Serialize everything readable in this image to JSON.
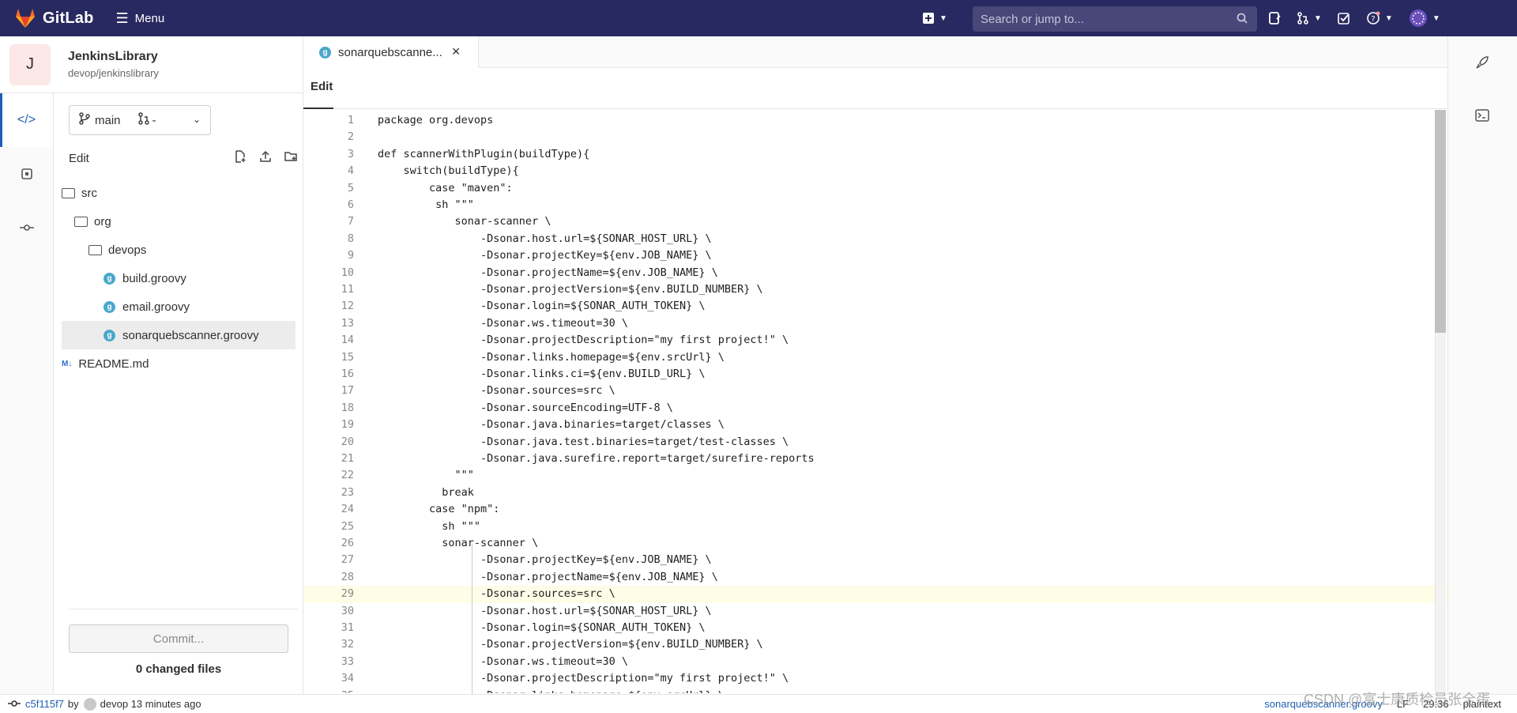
{
  "navbar": {
    "brand": "GitLab",
    "menu_label": "Menu",
    "search_placeholder": "Search or jump to...",
    "colors": {
      "background": "#292961",
      "accent": "#fc6d26"
    }
  },
  "project": {
    "avatar_letter": "J",
    "name": "JenkinsLibrary",
    "path": "devop/jenkinslibrary"
  },
  "tree": {
    "branch": "main",
    "mr": "-",
    "edit_label": "Edit",
    "items": [
      {
        "name": "src",
        "type": "folder",
        "indent": 0
      },
      {
        "name": "org",
        "type": "folder",
        "indent": 1
      },
      {
        "name": "devops",
        "type": "folder",
        "indent": 2
      },
      {
        "name": "build.groovy",
        "type": "groovy",
        "indent": 3
      },
      {
        "name": "email.groovy",
        "type": "groovy",
        "indent": 3
      },
      {
        "name": "sonarquebscanner.groovy",
        "type": "groovy",
        "indent": 3,
        "selected": true
      },
      {
        "name": "README.md",
        "type": "md",
        "indent": 0
      }
    ],
    "commit_label": "Commit...",
    "changed_files": "0 changed files"
  },
  "editor": {
    "tab_name": "sonarquebscanne...",
    "mode_label": "Edit",
    "highlight_line": 29,
    "lines": [
      "package org.devops",
      "",
      "def scannerWithPlugin(buildType){",
      "    switch(buildType){",
      "        case \"maven\":",
      "         sh \"\"\"",
      "            sonar-scanner \\",
      "                -Dsonar.host.url=${SONAR_HOST_URL} \\",
      "                -Dsonar.projectKey=${env.JOB_NAME} \\",
      "                -Dsonar.projectName=${env.JOB_NAME} \\",
      "                -Dsonar.projectVersion=${env.BUILD_NUMBER} \\",
      "                -Dsonar.login=${SONAR_AUTH_TOKEN} \\",
      "                -Dsonar.ws.timeout=30 \\",
      "                -Dsonar.projectDescription=\"my first project!\" \\",
      "                -Dsonar.links.homepage=${env.srcUrl} \\",
      "                -Dsonar.links.ci=${env.BUILD_URL} \\",
      "                -Dsonar.sources=src \\",
      "                -Dsonar.sourceEncoding=UTF-8 \\",
      "                -Dsonar.java.binaries=target/classes \\",
      "                -Dsonar.java.test.binaries=target/test-classes \\",
      "                -Dsonar.java.surefire.report=target/surefire-reports",
      "            \"\"\"",
      "          break",
      "        case \"npm\":",
      "          sh \"\"\"",
      "          sonar-scanner \\",
      "                -Dsonar.projectKey=${env.JOB_NAME} \\",
      "                -Dsonar.projectName=${env.JOB_NAME} \\",
      "                -Dsonar.sources=src \\",
      "                -Dsonar.host.url=${SONAR_HOST_URL} \\",
      "                -Dsonar.login=${SONAR_AUTH_TOKEN} \\",
      "                -Dsonar.projectVersion=${env.BUILD_NUMBER} \\",
      "                -Dsonar.ws.timeout=30 \\",
      "                -Dsonar.projectDescription=\"my first project!\" \\",
      "                -Dsonar.links.homepage=${env.srcUrl} \\"
    ]
  },
  "status": {
    "commit_sha": "c5f115f7",
    "by": "by",
    "author_time": "devop 13 minutes ago",
    "file_name": "sonarquebscanner.groovy",
    "eol": "LF",
    "cursor": "29:36",
    "language": "plaintext",
    "watermark": "CSDN @富士康质检员张全蛋"
  }
}
